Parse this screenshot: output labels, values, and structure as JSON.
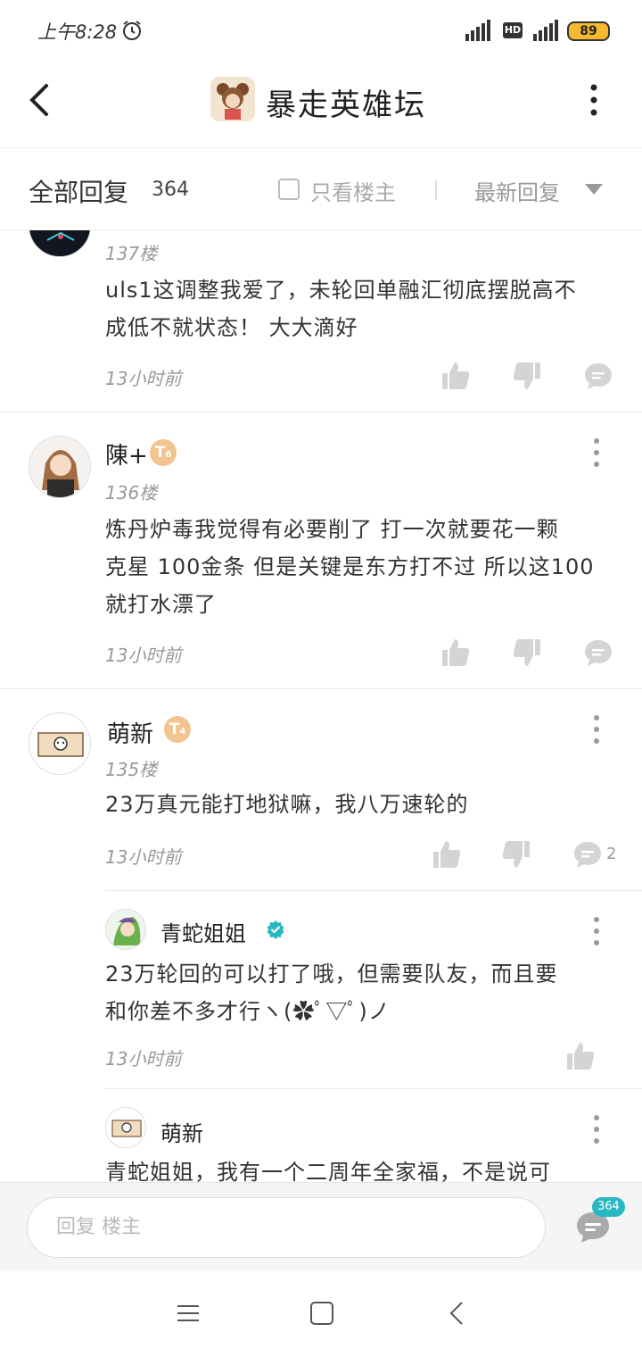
{
  "status_bar": {
    "time": "上午8:28",
    "battery": "89",
    "hd_label": "HD",
    "icons": [
      "alarm-icon",
      "signal-icon",
      "hd-icon",
      "signal-icon",
      "battery-icon"
    ]
  },
  "header": {
    "title": "暴走英雄坛",
    "icons": [
      "back-icon",
      "forum-logo",
      "more-vertical-icon"
    ]
  },
  "filter_bar": {
    "label": "全部回复",
    "count": "364",
    "only_op_label": "只看楼主",
    "sort_label": "最新回复"
  },
  "posts": [
    {
      "floor": "137楼",
      "content_lines": [
        "uls1这调整我爱了，未轮回单融汇彻底摆脱高不",
        "成低不就状态！ 大大滴好"
      ],
      "time": "13小时前"
    },
    {
      "name": "陳+",
      "level_badge": "T",
      "level_sub": "6",
      "floor": "136楼",
      "content_lines": [
        "炼丹炉毒我觉得有必要削了 打一次就要花一颗",
        "克星 100金条 但是关键是东方打不过 所以这100",
        "就打水漂了"
      ],
      "time": "13小时前"
    },
    {
      "name": "萌新",
      "level_badge": "T",
      "level_sub": "4",
      "floor": "135楼",
      "content_lines": [
        "23万真元能打地狱嘛，我八万速轮的"
      ],
      "time": "13小时前",
      "reply_count": "2",
      "replies": [
        {
          "name": "青蛇姐姐",
          "content_lines": [
            "23万轮回的可以打了哦，但需要队友，而且要",
            "和你差不多才行ヽ(✿ﾟ▽ﾟ)ノ"
          ],
          "time": "13小时前"
        },
        {
          "name": "萌新",
          "content_lines": [
            "青蛇姐姐，我有一个二周年全家福，不是说可"
          ]
        }
      ]
    }
  ],
  "reply_bar": {
    "placeholder": "回复 楼主",
    "badge": "364"
  },
  "nav_bar": {
    "icons": [
      "menu-icon",
      "home-square-icon",
      "back-triangle-icon"
    ]
  },
  "colors": {
    "accent": "#2ab7c4",
    "battery": "#f5b82e",
    "level_badge": "#f2c48f",
    "icon_gray": "#d4d4d4"
  }
}
